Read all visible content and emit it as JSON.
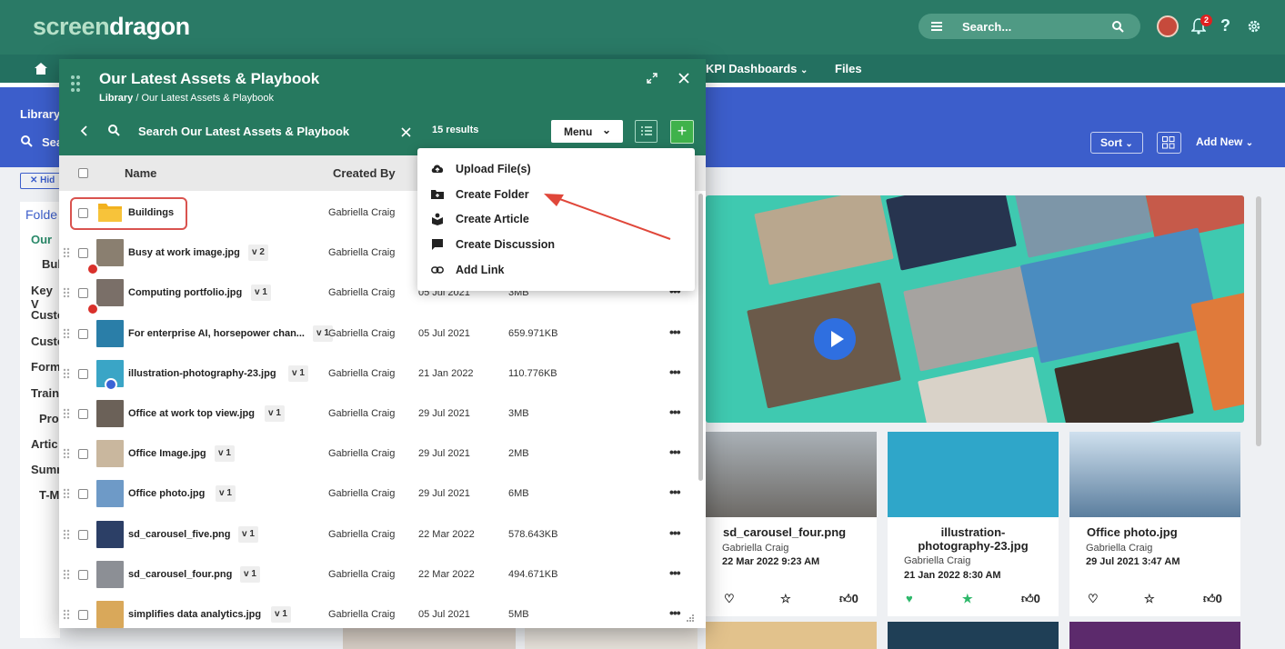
{
  "app": {
    "logo_a": "screen",
    "logo_b": "dragon"
  },
  "header": {
    "search_placeholder": "Search...",
    "notif_count": "2"
  },
  "nav": {
    "kpi": "KPI Dashboards",
    "files": "Files"
  },
  "library": {
    "title": "Library",
    "search_short": "Sea",
    "hide": "Hid",
    "folders": "Folde",
    "tree": [
      "Our",
      "Bul",
      "Key V",
      "Custo",
      "Custo",
      "Form",
      "Train",
      "Pro",
      "Artic",
      "Summ",
      "T-M"
    ]
  },
  "toolbar": {
    "sort": "Sort",
    "add_new": "Add New"
  },
  "modal": {
    "title": "Our Latest Assets & Playbook",
    "crumb_root": "Library",
    "crumb_sep": "/",
    "crumb_current": "Our Latest Assets & Playbook",
    "search_text": "Search Our Latest Assets & Playbook",
    "results": "15 results",
    "menu_label": "Menu",
    "add_label": "+",
    "col_name": "Name",
    "col_created": "Created By"
  },
  "rows": [
    {
      "name": "Buildings",
      "ver": "",
      "by": "Gabriella Craig",
      "date": "",
      "size": "",
      "thumb": "#f2b21f"
    },
    {
      "name": "Busy at work image.jpg",
      "ver": "v 2",
      "by": "Gabriella Craig",
      "date": "",
      "size": "",
      "thumb": "#8a7f70"
    },
    {
      "name": "Computing portfolio.jpg",
      "ver": "v 1",
      "by": "Gabriella Craig",
      "date": "05 Jul 2021",
      "size": "3MB",
      "thumb": "#7a6f68"
    },
    {
      "name": "For enterprise AI, horsepower chan...",
      "ver": "v 1",
      "by": "Gabriella Craig",
      "date": "05 Jul 2021",
      "size": "659.971KB",
      "thumb": "#2a7ea8"
    },
    {
      "name": "illustration-photography-23.jpg",
      "ver": "v 1",
      "by": "Gabriella Craig",
      "date": "21 Jan 2022",
      "size": "110.776KB",
      "thumb": "#3aa5c6"
    },
    {
      "name": "Office at work top view.jpg",
      "ver": "v 1",
      "by": "Gabriella Craig",
      "date": "29 Jul 2021",
      "size": "3MB",
      "thumb": "#6b6158"
    },
    {
      "name": "Office Image.jpg",
      "ver": "v 1",
      "by": "Gabriella Craig",
      "date": "29 Jul 2021",
      "size": "2MB",
      "thumb": "#c9b79e"
    },
    {
      "name": "Office photo.jpg",
      "ver": "v 1",
      "by": "Gabriella Craig",
      "date": "29 Jul 2021",
      "size": "6MB",
      "thumb": "#6e9ac7"
    },
    {
      "name": "sd_carousel_five.png",
      "ver": "v 1",
      "by": "Gabriella Craig",
      "date": "22 Mar 2022",
      "size": "578.643KB",
      "thumb": "#2c3f66"
    },
    {
      "name": "sd_carousel_four.png",
      "ver": "v 1",
      "by": "Gabriella Craig",
      "date": "22 Mar 2022",
      "size": "494.671KB",
      "thumb": "#8c8f95"
    },
    {
      "name": "simplifies data analytics.jpg",
      "ver": "v 1",
      "by": "Gabriella Craig",
      "date": "05 Jul 2021",
      "size": "5MB",
      "thumb": "#d9a85a"
    }
  ],
  "menu_items": [
    "Upload File(s)",
    "Create Folder",
    "Create Article",
    "Create Discussion",
    "Add Link"
  ],
  "cards": [
    {
      "title": "sd_carousel_four.png",
      "by": "Gabriella Craig",
      "date": "22 Mar 2022 9:23 AM",
      "likes": "0"
    },
    {
      "title": "illustration-photography-23.jpg",
      "by": "Gabriella Craig",
      "date": "21 Jan 2022 8:30 AM",
      "likes": "0"
    },
    {
      "title": "Office photo.jpg",
      "by": "Gabriella Craig",
      "date": "29 Jul 2021 3:47 AM",
      "likes": "0"
    }
  ],
  "colors": {
    "header": "#2a7a66",
    "band": "#3c5ecb",
    "accent": "#3fb24b",
    "highlight": "#d9534f"
  }
}
